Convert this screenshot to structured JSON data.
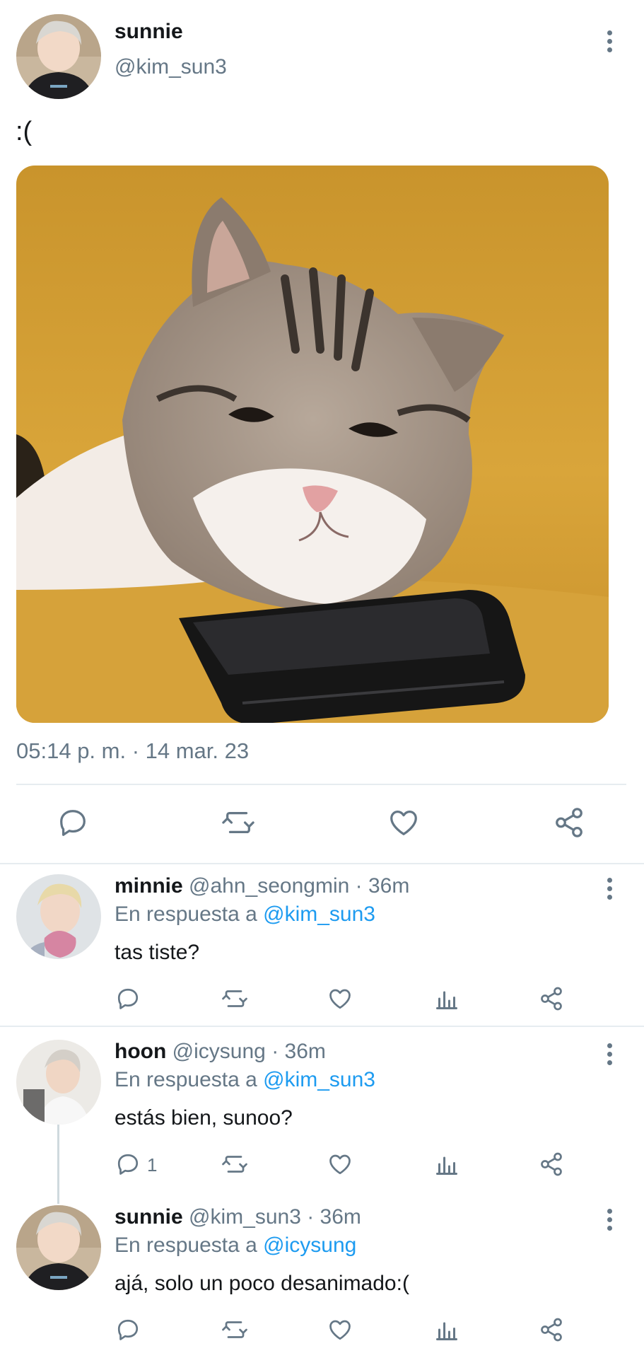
{
  "tweet": {
    "display_name": "sunnie",
    "handle": "@kim_sun3",
    "text": ":(",
    "media_alt": "cat resting chin on a phone",
    "timestamp": "05:14 p. m. · 14 mar. 23",
    "actions": [
      "reply-icon",
      "retweet-icon",
      "like-icon",
      "share-icon"
    ]
  },
  "replies": [
    {
      "display_name": "minnie",
      "handle": "@ahn_seongmin",
      "time": "· 36m",
      "reply_prefix": "En respuesta a",
      "reply_to": "@kim_sun3",
      "text": "tas tiste?",
      "reply_count": ""
    },
    {
      "display_name": "hoon",
      "handle": "@icysung",
      "time": "· 36m",
      "reply_prefix": "En respuesta a",
      "reply_to": "@kim_sun3",
      "text": "estás bien, sunoo?",
      "reply_count": "1"
    },
    {
      "display_name": "sunnie",
      "handle": "@kim_sun3",
      "time": "· 36m",
      "reply_prefix": "En respuesta a",
      "reply_to": "@icysung",
      "text": "ajá, solo un poco desanimado:(",
      "reply_count": ""
    }
  ],
  "colors": {
    "text": "#14171a",
    "muted": "#657786",
    "link": "#1d9bf0",
    "divider": "#e6ecf0"
  }
}
